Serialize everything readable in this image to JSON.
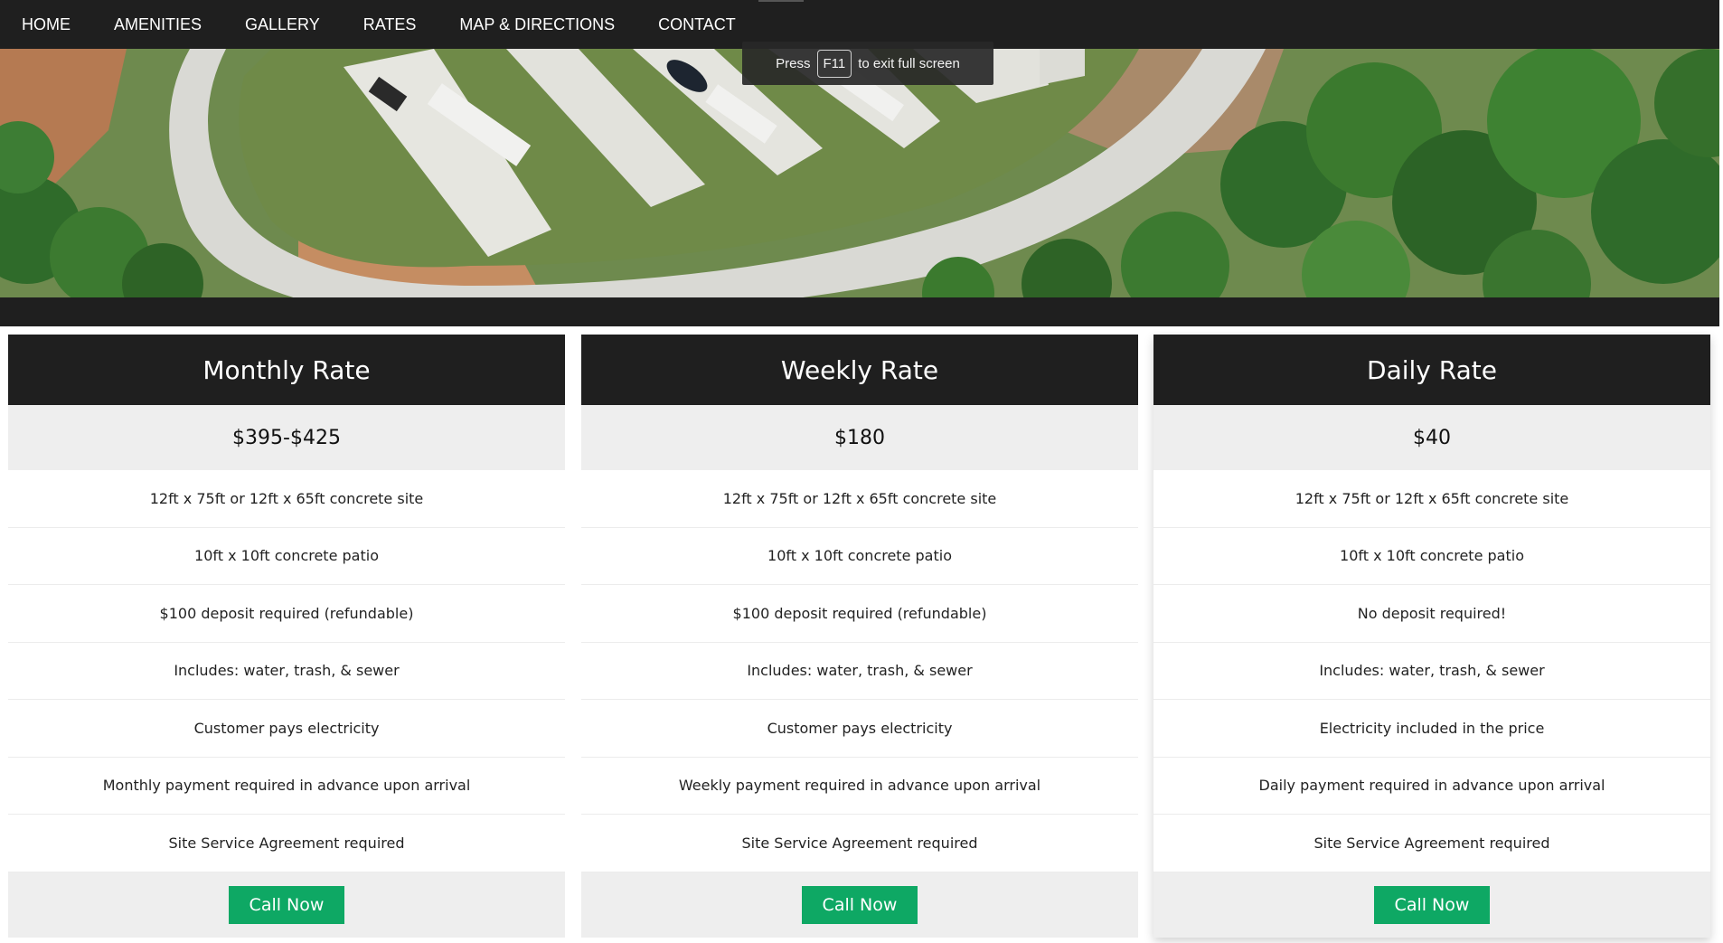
{
  "nav": {
    "items": [
      {
        "label": "HOME"
      },
      {
        "label": "AMENITIES"
      },
      {
        "label": "GALLERY"
      },
      {
        "label": "RATES"
      },
      {
        "label": "MAP & DIRECTIONS"
      },
      {
        "label": "CONTACT"
      }
    ]
  },
  "fullscreen_notice": {
    "prefix": "Press",
    "key": "F11",
    "suffix": "to exit full screen"
  },
  "cards": [
    {
      "title": "Monthly Rate",
      "price": "$395-$425",
      "features": [
        "12ft x 75ft or 12ft x 65ft concrete site",
        "10ft x 10ft concrete patio",
        "$100 deposit required (refundable)",
        "Includes: water, trash, & sewer",
        "Customer pays electricity",
        "Monthly payment required in advance upon arrival",
        "Site Service Agreement required"
      ],
      "button": "Call Now"
    },
    {
      "title": "Weekly Rate",
      "price": "$180",
      "features": [
        "12ft x 75ft or 12ft x 65ft concrete site",
        "10ft x 10ft concrete patio",
        "$100 deposit required (refundable)",
        "Includes: water, trash, & sewer",
        "Customer pays electricity",
        "Weekly payment required in advance upon arrival",
        "Site Service Agreement required"
      ],
      "button": "Call Now"
    },
    {
      "title": "Daily Rate",
      "price": "$40",
      "features": [
        "12ft x 75ft or 12ft x 65ft concrete site",
        "10ft x 10ft concrete patio",
        "No deposit required!",
        "Includes: water, trash, & sewer",
        "Electricity included in the price",
        "Daily payment required in advance upon arrival",
        "Site Service Agreement required"
      ],
      "button": "Call Now"
    }
  ],
  "colors": {
    "nav_bg": "#1f1f1f",
    "accent_button": "#0ea864",
    "price_bg": "#eeeeee"
  }
}
